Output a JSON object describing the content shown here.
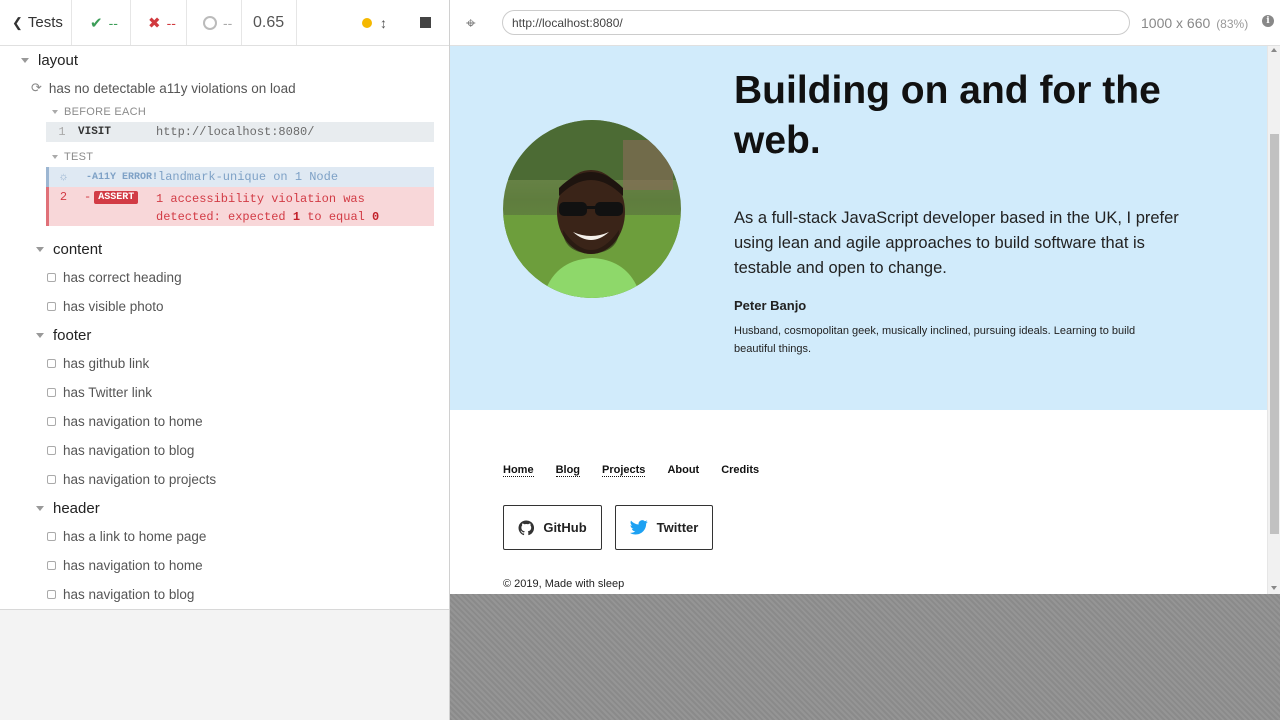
{
  "reporter": {
    "header": {
      "tests_label": "Tests",
      "passed": "--",
      "failed": "--",
      "pending": "--",
      "duration": "0.65"
    },
    "suites": {
      "layout": {
        "title": "layout",
        "test_title": "has no detectable a11y violations on load",
        "before_each_label": "BEFORE EACH",
        "test_label": "TEST",
        "commands": {
          "visit": {
            "num": "1",
            "name": "VISIT",
            "message": "http://localhost:8080/"
          },
          "a11y": {
            "num": "",
            "name": "-A11Y ERROR!",
            "message": "landmark-unique on 1 Node"
          },
          "assert": {
            "num": "2",
            "prefix": "-",
            "name": "ASSERT",
            "message_start": "1 accessibility violation was detected: expected ",
            "expected": "1",
            "mid": " to equal ",
            "actual": "0"
          }
        }
      },
      "content": {
        "title": "content",
        "tests": [
          "has correct heading",
          "has visible photo"
        ]
      },
      "footer": {
        "title": "footer",
        "tests": [
          "has github link",
          "has Twitter link",
          "has navigation to home",
          "has navigation to blog",
          "has navigation to projects"
        ]
      },
      "header": {
        "title": "header",
        "tests": [
          "has a link to home page",
          "has navigation to home",
          "has navigation to blog"
        ]
      }
    }
  },
  "aut": {
    "url": "http://localhost:8080/",
    "viewport": "1000 x 660",
    "scale": "(83%)",
    "page": {
      "hero_title": "Building on and for the web.",
      "hero_description": "As a full-stack JavaScript developer based in the UK, I prefer using lean and agile approaches to build software that is testable and open to change.",
      "author_name": "Peter Banjo",
      "author_bio": "Husband, cosmopolitan geek, musically inclined, pursuing ideals. Learning to build beautiful things.",
      "footer_nav": [
        "Home",
        "Blog",
        "Projects",
        "About",
        "Credits"
      ],
      "github_label": "GitHub",
      "twitter_label": "Twitter",
      "copyright": "© 2019, Made with sleep"
    }
  },
  "colors": {
    "passed": "#3c9d58",
    "failed": "#d13a3f",
    "running": "#f5b800",
    "hero_bg": "#d1ebfb",
    "twitter": "#1da1f2"
  }
}
